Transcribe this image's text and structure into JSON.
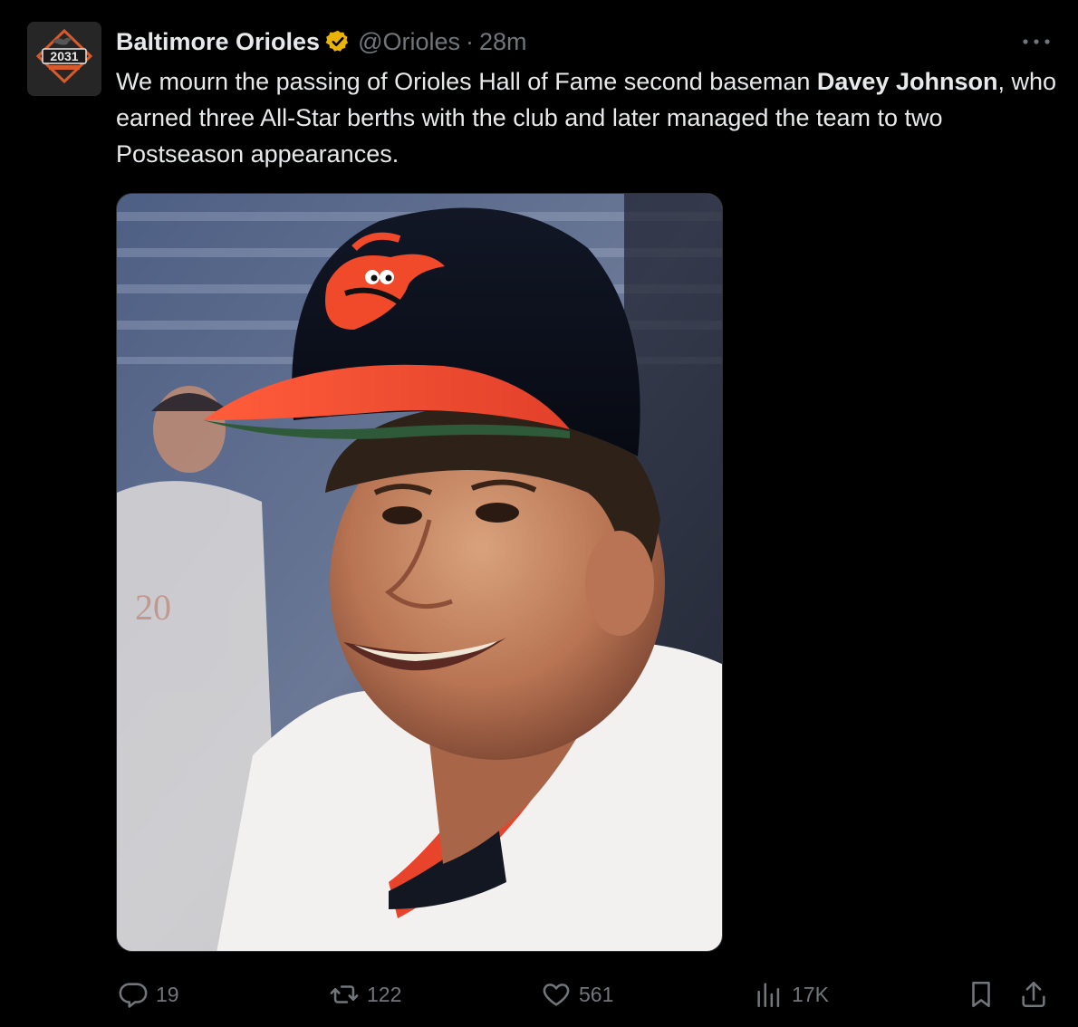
{
  "author": {
    "display_name": "Baltimore Orioles",
    "handle": "@Orioles",
    "separator": "·",
    "time": "28m",
    "verified_badge_color": "#e9b308",
    "avatar_text": "2031"
  },
  "tweet": {
    "text_part1": "We mourn the passing of Orioles Hall of Fame second baseman ",
    "text_bold": "Davey Johnson",
    "text_part2": ", who earned three All-Star berths with the club and later managed the team to two Postseason appearances."
  },
  "media": {
    "type": "photo",
    "subject": "player-portrait"
  },
  "actions": {
    "replies": "19",
    "reposts": "122",
    "likes": "561",
    "views": "17K"
  },
  "icons": {
    "more": "more-icon",
    "reply": "reply-icon",
    "repost": "repost-icon",
    "like": "like-icon",
    "views": "views-icon",
    "bookmark": "bookmark-icon",
    "share": "share-icon"
  },
  "colors": {
    "background": "#000000",
    "text_primary": "#e7e9ea",
    "text_secondary": "#71767b",
    "orioles_orange": "#f04a2a"
  }
}
